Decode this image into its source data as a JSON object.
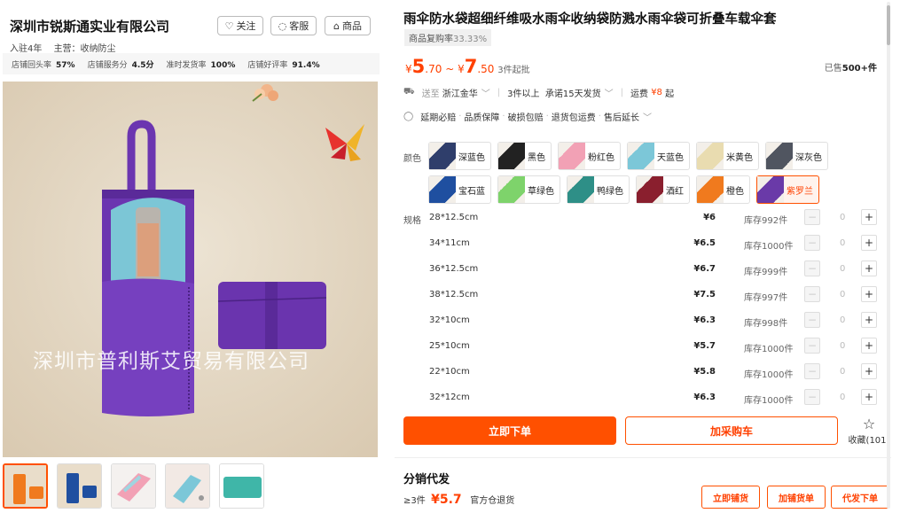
{
  "shop": {
    "name": "深圳市锐斯通实业有限公司",
    "follow": "关注",
    "service": "客服",
    "goods": "商品",
    "years": "入驻4年",
    "main_business": "主营：收纳防尘",
    "stats": [
      {
        "label": "店铺回头率",
        "value": "57%"
      },
      {
        "label": "店铺服务分",
        "value": "4.5分"
      },
      {
        "label": "准时发货率",
        "value": "100%"
      },
      {
        "label": "店铺好评率",
        "value": "91.4%"
      }
    ]
  },
  "gallery": {
    "watermark": "深圳市普利斯艾贸易有限公司",
    "thumbnails": [
      "橙色",
      "宝石蓝",
      "粉红色",
      "天蓝色",
      "鸭绿色"
    ]
  },
  "product": {
    "title": "雨伞防水袋超细纤维吸水雨伞收纳袋防溅水雨伞袋可折叠车载伞套",
    "repurchase_label": "商品复购率",
    "repurchase_value": "33.33%",
    "price_symbol": "¥",
    "price_low_int": "5",
    "price_low_dec": ".70",
    "price_tilde": "~",
    "price_high_int": "7",
    "price_high_dec": ".50",
    "moq": "3件起批",
    "sold_prefix": "已售",
    "sold_value": "500+",
    "sold_unit": "件"
  },
  "shipping": {
    "to_label": "送至",
    "to_value": "浙江金华",
    "lead": "3件以上",
    "promise": "承诺15天发货",
    "fee_label": "运费",
    "fee_value": "¥8",
    "fee_suffix": "起"
  },
  "guarantees": [
    "延期必赔",
    "品质保障",
    "破损包赔",
    "退货包运费",
    "售后延长"
  ],
  "colors": {
    "label": "颜色",
    "selected": "紫罗兰",
    "options": [
      {
        "name": "深蓝色",
        "color": "#2f3e6b"
      },
      {
        "name": "黑色",
        "color": "#222222"
      },
      {
        "name": "粉红色",
        "color": "#f2a1b5"
      },
      {
        "name": "天蓝色",
        "color": "#7cc7d8"
      },
      {
        "name": "米黄色",
        "color": "#e9dcb0"
      },
      {
        "name": "深灰色",
        "color": "#505560"
      },
      {
        "name": "宝石蓝",
        "color": "#1f4fa0"
      },
      {
        "name": "草绿色",
        "color": "#7ed36b"
      },
      {
        "name": "鸭绿色",
        "color": "#2e8f87"
      },
      {
        "name": "酒红",
        "color": "#8a1f2e"
      },
      {
        "name": "橙色",
        "color": "#f07a1e"
      },
      {
        "name": "紫罗兰",
        "color": "#6a3aa8"
      }
    ]
  },
  "specs": {
    "label": "规格",
    "rows": [
      {
        "name": "28*12.5cm",
        "price": "¥6",
        "stock": "库存992件",
        "qty": "0"
      },
      {
        "name": "34*11cm",
        "price": "¥6.5",
        "stock": "库存1000件",
        "qty": "0"
      },
      {
        "name": "36*12.5cm",
        "price": "¥6.7",
        "stock": "库存999件",
        "qty": "0"
      },
      {
        "name": "38*12.5cm",
        "price": "¥7.5",
        "stock": "库存997件",
        "qty": "0"
      },
      {
        "name": "32*10cm",
        "price": "¥6.3",
        "stock": "库存998件",
        "qty": "0"
      },
      {
        "name": "25*10cm",
        "price": "¥5.7",
        "stock": "库存1000件",
        "qty": "0"
      },
      {
        "name": "22*10cm",
        "price": "¥5.8",
        "stock": "库存1000件",
        "qty": "0"
      },
      {
        "name": "32*12cm",
        "price": "¥6.3",
        "stock": "库存1000件",
        "qty": "0"
      }
    ]
  },
  "actions": {
    "buy_now": "立即下单",
    "add_cart": "加采购车",
    "favorite": "收藏",
    "favorite_count": "(101)"
  },
  "distribution": {
    "title": "分销代发",
    "moq": "≥3件",
    "price": "¥5.7",
    "note": "官方仓退货",
    "btn_stock": "立即铺货",
    "btn_add": "加铺货单",
    "btn_dropship": "代发下单"
  },
  "accent": "#ff5000"
}
